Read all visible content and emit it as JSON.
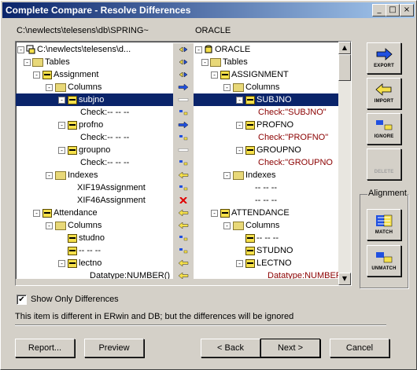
{
  "window": {
    "title": "Complete Compare - Resolve Differences",
    "controls": [
      "_",
      "□",
      "×"
    ]
  },
  "left_path": "C:\\newlects\\telesens\\db\\SPRING~",
  "right_path": "ORACLE",
  "tree_rows": [
    {
      "left": "C:\\newlects\\telesens\\d...",
      "right": "ORACLE",
      "action": "toggle"
    },
    {
      "left": "Tables",
      "right": "Tables",
      "action": "toggle"
    },
    {
      "left": "Assignment",
      "right": "ASSIGNMENT",
      "action": "toggle"
    },
    {
      "left": "Columns",
      "right": "Columns",
      "action": "arrow-right"
    },
    {
      "left": "subjno",
      "right": "SUBJNO",
      "action": "ignore"
    },
    {
      "left": "Check:-- -- --",
      "right": "Check:\"SUBJNO\"",
      "action": "eq"
    },
    {
      "left": "profno",
      "right": "PROFNO",
      "action": "arrow-right"
    },
    {
      "left": "Check:-- -- --",
      "right": "Check:\"PROFNO\"",
      "action": "eq"
    },
    {
      "left": "groupno",
      "right": "GROUPNO",
      "action": "ignore"
    },
    {
      "left": "Check:-- -- --",
      "right": "Check:\"GROUPNO",
      "action": "eq"
    },
    {
      "left": "Indexes",
      "right": "Indexes",
      "action": "arrow-left"
    },
    {
      "left": "XIF19Assignment",
      "right": "-- -- --",
      "action": "eq"
    },
    {
      "left": "XIF46Assignment",
      "right": "-- -- --",
      "action": "delete"
    },
    {
      "left": "Attendance",
      "right": "ATTENDANCE",
      "action": "arrow-left"
    },
    {
      "left": "Columns",
      "right": "Columns",
      "action": "arrow-left"
    },
    {
      "left": "studno",
      "right": "-- -- --",
      "action": "eq"
    },
    {
      "left": "-- -- --",
      "right": "STUDNO",
      "action": "eq"
    },
    {
      "left": "lectno",
      "right": "LECTNO",
      "action": "arrow-left"
    },
    {
      "left": "Datatype:NUMBER()",
      "right": "Datatype:NUMBER",
      "action": "arrow-left"
    }
  ],
  "side_buttons": {
    "export": "EXPORT",
    "import": "IMPORT",
    "ignore": "IGNORE",
    "delete": "DELETE",
    "match": "MATCH",
    "unmatch": "UNMATCH"
  },
  "alignment_label": "Alignment",
  "show_only_differences": "Show Only Differences",
  "status_text": "This item is different in ERwin and DB; but the differences will be ignored",
  "buttons": {
    "report": "Report...",
    "preview": "Preview",
    "back": "< Back",
    "next": "Next >",
    "cancel": "Cancel"
  }
}
